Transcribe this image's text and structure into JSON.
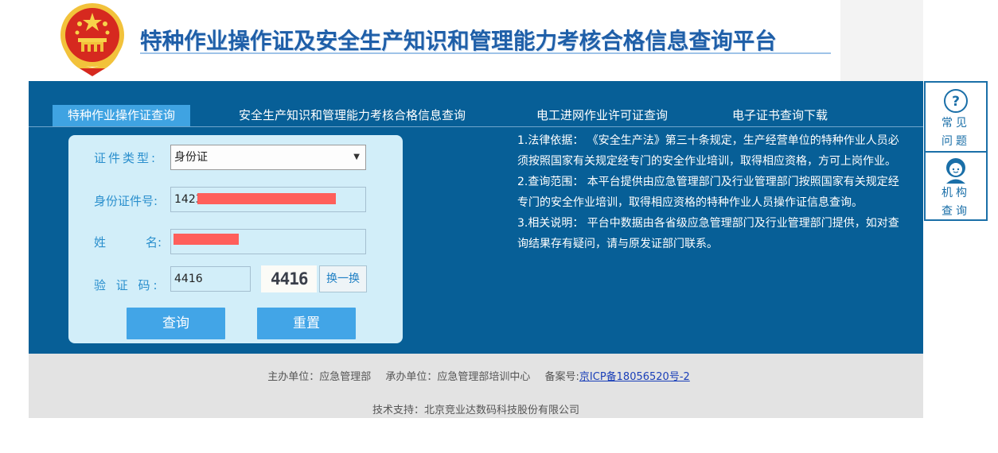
{
  "header": {
    "site_title": "特种作业操作证及安全生产知识和管理能力考核合格信息查询平台"
  },
  "tabs": [
    {
      "label": "特种作业操作证查询",
      "active": true
    },
    {
      "label": "安全生产知识和管理能力考核合格信息查询",
      "active": false
    },
    {
      "label": "电工进网作业许可证查询",
      "active": false
    },
    {
      "label": "电子证书查询下载",
      "active": false
    }
  ],
  "form": {
    "id_type_label": "证件类型:",
    "id_type_value": "身份证",
    "id_number_label": "身份证件号:",
    "id_number_value": "1423",
    "name_label_1": "姓",
    "name_label_2": "名:",
    "name_value": "",
    "captcha_label": "验 证 码:",
    "captcha_value": "4416",
    "captcha_image_text": "4416",
    "swap_label": "换一换",
    "query_label": "查询",
    "reset_label": "重置"
  },
  "notes": [
    "1.法律依据： 《安全生产法》第三十条规定，生产经营单位的特种作业人员必须按照国家有关规定经专门的安全作业培训，取得相应资格，方可上岗作业。",
    "2.查询范围： 本平台提供由应急管理部门及行业管理部门按照国家有关规定经专门的安全作业培训，取得相应资格的特种作业人员操作证信息查询。",
    "3.相关说明： 平台中数据由各省级应急管理部门及行业管理部门提供，如对查询结果存有疑问，请与原发证部门联系。"
  ],
  "side_panel": {
    "faq_label_1": "常见",
    "faq_label_2": "问题",
    "agency_label_1": "机构",
    "agency_label_2": "查询"
  },
  "footer": {
    "sponsor": "主办单位：应急管理部",
    "organizer": "承办单位：应急管理部培训中心",
    "icp_label": "备案号:",
    "icp_link": "京ICP备18056520号-2",
    "tech_support": "技术支持：北京竞业达数码科技股份有限公司"
  },
  "colors": {
    "main_blue": "#075f97",
    "active_tab": "#3fa3e2",
    "button_blue": "#42a5e7",
    "form_bg": "#d2eef9",
    "redaction": "#ff5f5b"
  }
}
